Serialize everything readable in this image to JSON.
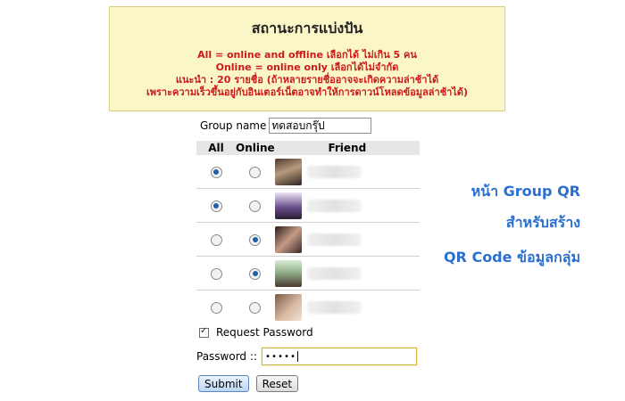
{
  "status": {
    "title": "สถานะการแบ่งปัน",
    "line1": "All = online and offline เลือกได้ ไม่เกิน 5 คน",
    "line2": "Online = online only เลือกได้ไม่จำกัด",
    "line3": "แนะนำ : 20 รายชื่อ (ถ้าหลายรายชื่ออาจจะเกิดความล่าช้าได้",
    "line4": "เพราะความเร็วขึ้นอยู่กับอินเตอร์เน็ตอาจทำให้การดาวน์โหลดข้อมูลล่าช้าได้)"
  },
  "form": {
    "group_name_label": "Group name",
    "group_name_value": "ทดสอบกรุ๊ป",
    "headers": {
      "all": "All",
      "online": "Online",
      "friend": "Friend"
    },
    "rows": [
      {
        "mode": "all"
      },
      {
        "mode": "all"
      },
      {
        "mode": "online"
      },
      {
        "mode": "online"
      },
      {
        "mode": "none"
      }
    ],
    "request_password_label": "Request Password",
    "request_password_checked": true,
    "password_label": "Password ::",
    "password_value": "•••••",
    "submit_label": "Submit",
    "reset_label": "Reset"
  },
  "caption": {
    "line1": "หน้า Group QR",
    "line2": "สำหรับสร้าง",
    "line3": "QR Code ข้อมูลกลุ่ม"
  },
  "colors": {
    "caption": "#2b6fd1",
    "notice_text": "#cc1a1a",
    "notice_bg": "#fbf6c8"
  }
}
